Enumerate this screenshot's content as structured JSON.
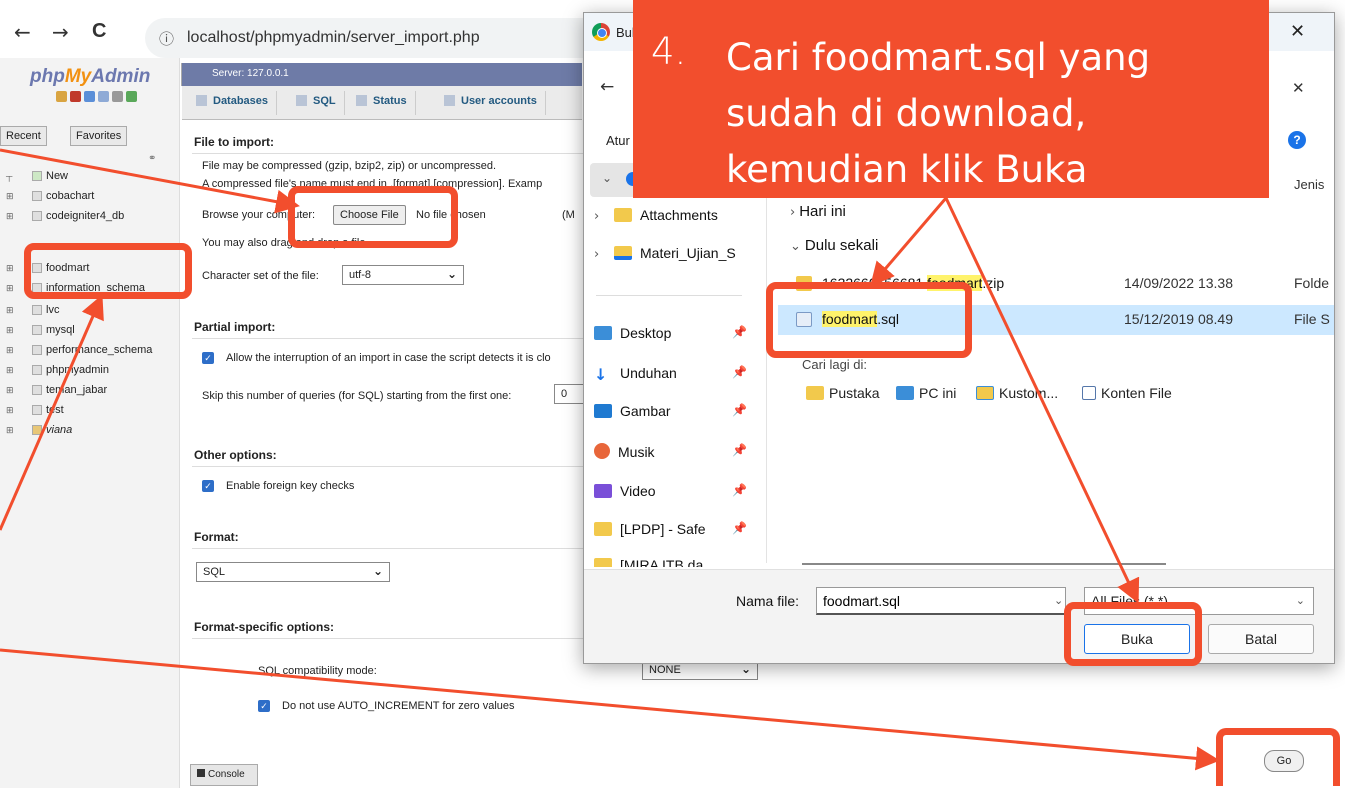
{
  "browser": {
    "back_glyph": "←",
    "forward_glyph": "→",
    "reload_glyph": "C",
    "info_glyph": "ⓘ",
    "url": "localhost/phpmyadmin/server_import.php"
  },
  "pma": {
    "logo_php": "php",
    "logo_my": "My",
    "logo_admin": "Admin",
    "nav_tabs": [
      "Recent",
      "Favorites"
    ],
    "tree": [
      {
        "label": "New"
      },
      {
        "label": "cobachart"
      },
      {
        "label": "codeigniter4_db"
      },
      {
        "label": "foodmart"
      },
      {
        "label": "information_schema"
      },
      {
        "label": "lvc"
      },
      {
        "label": "mysql"
      },
      {
        "label": "performance_schema"
      },
      {
        "label": "phpmyadmin"
      },
      {
        "label": "teman_jabar"
      },
      {
        "label": "test"
      },
      {
        "label": "viana"
      }
    ],
    "server_label": "Server: 127.0.0.1",
    "tabs": [
      "Databases",
      "SQL",
      "Status",
      "User accounts"
    ],
    "file_to_import": {
      "legend": "File to import:",
      "line1": "File may be compressed (gzip, bzip2, zip) or uncompressed.",
      "line2": "A compressed file's name must end in .[format].[compression]. Examp",
      "browse_label": "Browse your computer:",
      "choose_button": "Choose File",
      "no_file": "No file chosen",
      "max_hint": "(M",
      "drag_hint": "You may also drag and drop a file",
      "charset_label": "Character set of the file:",
      "charset_value": "utf-8"
    },
    "partial_import": {
      "legend": "Partial import:",
      "allow_interrupt": "Allow the interruption of an import in case the script detects it is clo",
      "skip_label": "Skip this number of queries (for SQL) starting from the first one:",
      "skip_value": "0"
    },
    "other_options": {
      "legend": "Other options:",
      "foreign_key": "Enable foreign key checks"
    },
    "format": {
      "legend": "Format:",
      "value": "SQL"
    },
    "format_specific": {
      "legend": "Format-specific options:",
      "compat_label": "SQL compatibility mode:",
      "compat_value": "NONE",
      "auto_increment": "Do not use AUTO_INCREMENT for zero values"
    },
    "console_label": "Console",
    "go_button": "Go"
  },
  "dialog": {
    "title": "Buka",
    "close_glyph": "✕",
    "back_glyph": "←",
    "clear_glyph": "✕",
    "organize": "Atur",
    "help_glyph": "?",
    "col_type": "Jenis",
    "sidebar": [
      {
        "label": "Attachments",
        "kind": "folder",
        "expandable": true
      },
      {
        "label": "Materi_Ujian_S",
        "kind": "shared",
        "expandable": true
      },
      {
        "label": "Desktop",
        "kind": "desktop",
        "pinned": true
      },
      {
        "label": "Unduhan",
        "kind": "download",
        "pinned": true
      },
      {
        "label": "Gambar",
        "kind": "pictures",
        "pinned": true
      },
      {
        "label": "Musik",
        "kind": "music",
        "pinned": true
      },
      {
        "label": "Video",
        "kind": "video",
        "pinned": true
      },
      {
        "label": "[LPDP] - Safe",
        "kind": "folder",
        "pinned": true
      },
      {
        "label": "[MIRA ITB da",
        "kind": "folder",
        "pinned": true
      }
    ],
    "group_today": "Hari ini",
    "group_older": "Dulu sekali",
    "files": [
      {
        "name_prefix": "1632660556681 ",
        "name_highlight": "foodmart",
        "name_suffix": ".zip",
        "date": "14/09/2022 13.38",
        "type": "Folde",
        "icon": "zip"
      },
      {
        "name_prefix": "",
        "name_highlight": "foodmart",
        "name_suffix": ".sql",
        "date": "15/12/2019 08.49",
        "type": "File S",
        "icon": "sql",
        "selected": true
      }
    ],
    "search_again": "Cari lagi di:",
    "search_locations": [
      "Pustaka",
      "PC ini",
      "Kustom...",
      "Konten File"
    ],
    "filename_label": "Nama file:",
    "filename_value": "foodmart.sql",
    "filetype_value": "All Files (*.*)",
    "open_button": "Buka",
    "cancel_button": "Batal"
  },
  "annotation": {
    "step_number": "4.",
    "step_text": "Cari foodmart.sql yang sudah di download, kemudian klik Buka",
    "color": "#f24e2d"
  }
}
